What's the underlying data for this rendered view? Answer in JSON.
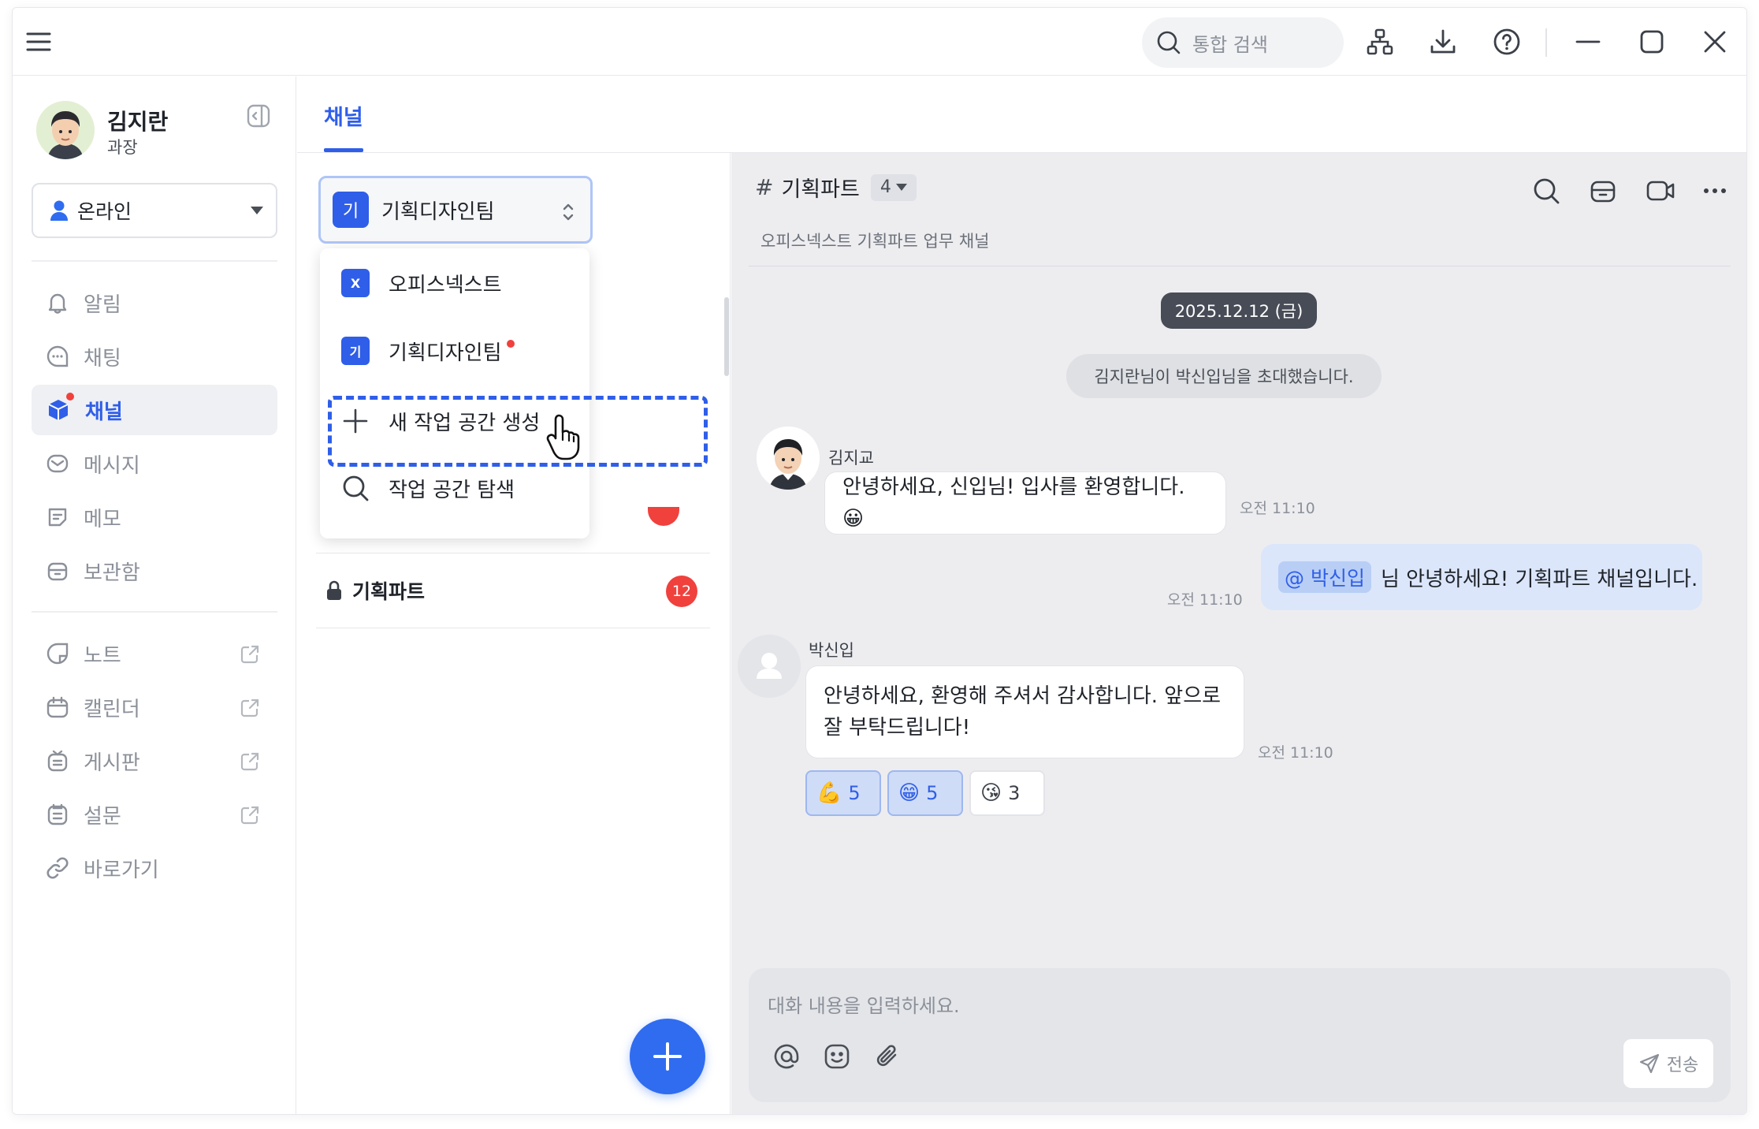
{
  "titlebar": {
    "search_placeholder": "통합 검색",
    "icons": [
      "menu-icon",
      "search-icon",
      "org-chart-icon",
      "download-icon",
      "help-icon",
      "minimize-icon",
      "maximize-icon",
      "close-icon"
    ]
  },
  "profile": {
    "name": "김지란",
    "role": "과장",
    "status": "온라인"
  },
  "sidebar": {
    "items": [
      {
        "label": "알림",
        "icon": "bell-icon"
      },
      {
        "label": "채팅",
        "icon": "chat-icon"
      },
      {
        "label": "채널",
        "icon": "channel-icon",
        "active": true
      },
      {
        "label": "메시지",
        "icon": "message-icon"
      },
      {
        "label": "메모",
        "icon": "memo-icon"
      },
      {
        "label": "보관함",
        "icon": "archive-icon"
      }
    ],
    "apps": [
      {
        "label": "노트",
        "icon": "note-icon"
      },
      {
        "label": "캘린더",
        "icon": "calendar-icon"
      },
      {
        "label": "게시판",
        "icon": "board-icon"
      },
      {
        "label": "설문",
        "icon": "survey-icon"
      },
      {
        "label": "바로가기",
        "icon": "link-icon"
      }
    ]
  },
  "channels": {
    "tab": "채널",
    "workspace": {
      "chip": "기",
      "name": "기획디자인팀"
    },
    "dropdown": {
      "items": [
        {
          "chip": "X",
          "label": "오피스넥스트"
        },
        {
          "chip": "기",
          "label": "기획디자인팀"
        },
        {
          "label": "새 작업 공간 생성"
        },
        {
          "label": "작업 공간 탐색"
        }
      ]
    },
    "list": [
      {
        "name": "기획파트",
        "count": "12"
      }
    ]
  },
  "chat": {
    "channel_name": "기획파트",
    "member_count": "4",
    "description": "오피스넥스트 기획파트 업무 채널",
    "date": "2025.12.12 (금)",
    "system": "김지란님이 박신입님을 초대했습니다.",
    "messages": [
      {
        "sender": "김지교",
        "text": "안녕하세요, 신입님! 입사를 환영합니다. 😀",
        "time": "오전 11:10"
      },
      {
        "mention": "@ 박신입",
        "text": "님 안녕하세요! 기획파트 채널입니다.",
        "time": "오전 11:10"
      },
      {
        "sender": "박신입",
        "line1": "안녕하세요, 환영해 주셔서 감사합니다. 앞으로",
        "line2": "잘 부탁드립니다!",
        "time": "오전 11:10"
      }
    ],
    "reactions": [
      {
        "emoji": "💪",
        "count": "5"
      },
      {
        "emoji": "😁",
        "count": "5"
      },
      {
        "emoji": "😘",
        "count": "3"
      }
    ],
    "composer": {
      "placeholder": "대화 내용을 입력하세요.",
      "send": "전송"
    }
  },
  "colors": {
    "accent": "#2f5ee8",
    "badge": "#f0413d",
    "chat_bg": "#ededf0"
  }
}
